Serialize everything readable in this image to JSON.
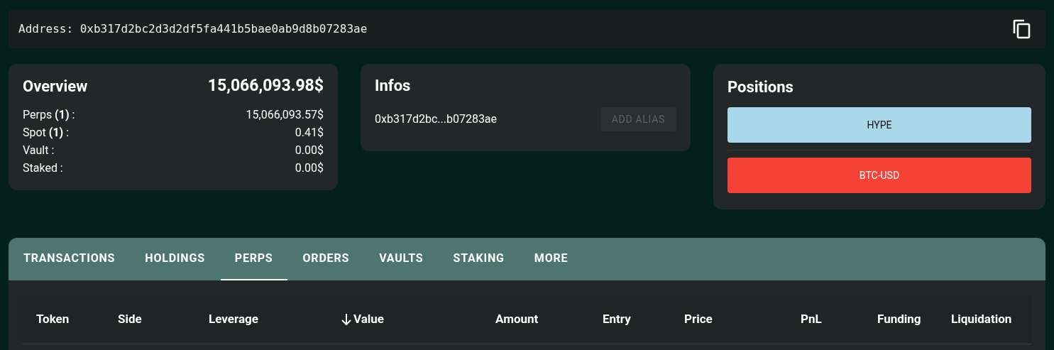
{
  "address_bar": {
    "label": "Address:",
    "value": "0xb317d2bc2d3d2df5fa441b5bae0ab9d8b07283ae"
  },
  "overview": {
    "title": "Overview",
    "total": "15,066,093.98$",
    "rows": [
      {
        "label": "Perps **(1)** :",
        "value": "15,066,093.57$"
      },
      {
        "label": "Spot **(1)** :",
        "value": "0.41$"
      },
      {
        "label": "Vault :",
        "value": "0.00$"
      },
      {
        "label": "Staked :",
        "value": "0.00$"
      }
    ]
  },
  "infos": {
    "title": "Infos",
    "address": "0xb317d2bc...b07283ae",
    "button": {
      "label": "ADD ALIAS",
      "disabled": true
    }
  },
  "positions": {
    "title": "Positions",
    "items": [
      {
        "label": "HYPE",
        "color": "#a9d8ea"
      },
      {
        "label": "BTC-USD",
        "color": "#f44336"
      }
    ]
  },
  "tabs": [
    {
      "label": "TRANSACTIONS",
      "selected": false
    },
    {
      "label": "HOLDINGS",
      "selected": false
    },
    {
      "label": "PERPS",
      "selected": true
    },
    {
      "label": "ORDERS",
      "selected": false
    },
    {
      "label": "VAULTS",
      "selected": false
    },
    {
      "label": "STAKING",
      "selected": false
    },
    {
      "label": "MORE",
      "selected": false
    }
  ],
  "table": {
    "columns": [
      {
        "label": "Token",
        "sorted": false
      },
      {
        "label": "Side",
        "sorted": false
      },
      {
        "label": "Leverage",
        "sorted": false
      },
      {
        "label": "Value",
        "sorted": true
      },
      {
        "label": "Amount",
        "sorted": false
      },
      {
        "label": "Entry",
        "sorted": false
      },
      {
        "label": "Price",
        "sorted": false
      },
      {
        "label": "PnL",
        "sorted": false
      },
      {
        "label": "Funding",
        "sorted": false
      },
      {
        "label": "Liquidation",
        "sorted": false
      }
    ]
  }
}
